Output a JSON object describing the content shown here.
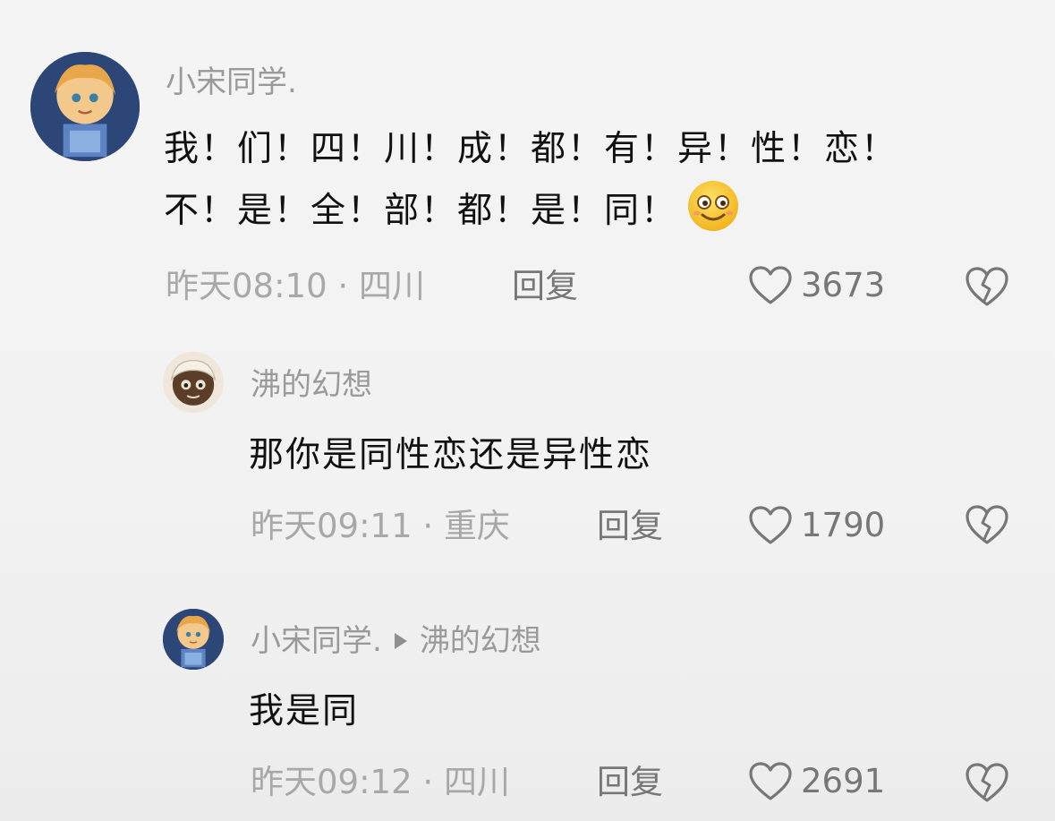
{
  "comments": [
    {
      "username": "小宋同学.",
      "content_lines": [
        "我！们！四！川！成！都！有！异！性！恋！",
        "不！是！全！部！都！是！同！"
      ],
      "emoji": "smiling-face-emoji",
      "time": "昨天08:10",
      "location": "四川",
      "reply_label": "回复",
      "likes": "3673"
    },
    {
      "username": "沸的幻想",
      "content_lines": [
        "那你是同性恋还是异性恋"
      ],
      "time": "昨天09:11",
      "location": "重庆",
      "reply_label": "回复",
      "likes": "1790"
    },
    {
      "username": "小宋同学.",
      "reply_to": "沸的幻想",
      "content_lines": [
        "我是同"
      ],
      "time": "昨天09:12",
      "location": "四川",
      "reply_label": "回复",
      "likes": "2691"
    }
  ],
  "separator": " · ",
  "icons": {
    "like": "heart-outline-icon",
    "dislike": "broken-heart-icon"
  },
  "colors": {
    "background": "#f2f2f2",
    "username": "#9a9a9a",
    "content": "#111111",
    "meta": "#a8a8a8"
  }
}
